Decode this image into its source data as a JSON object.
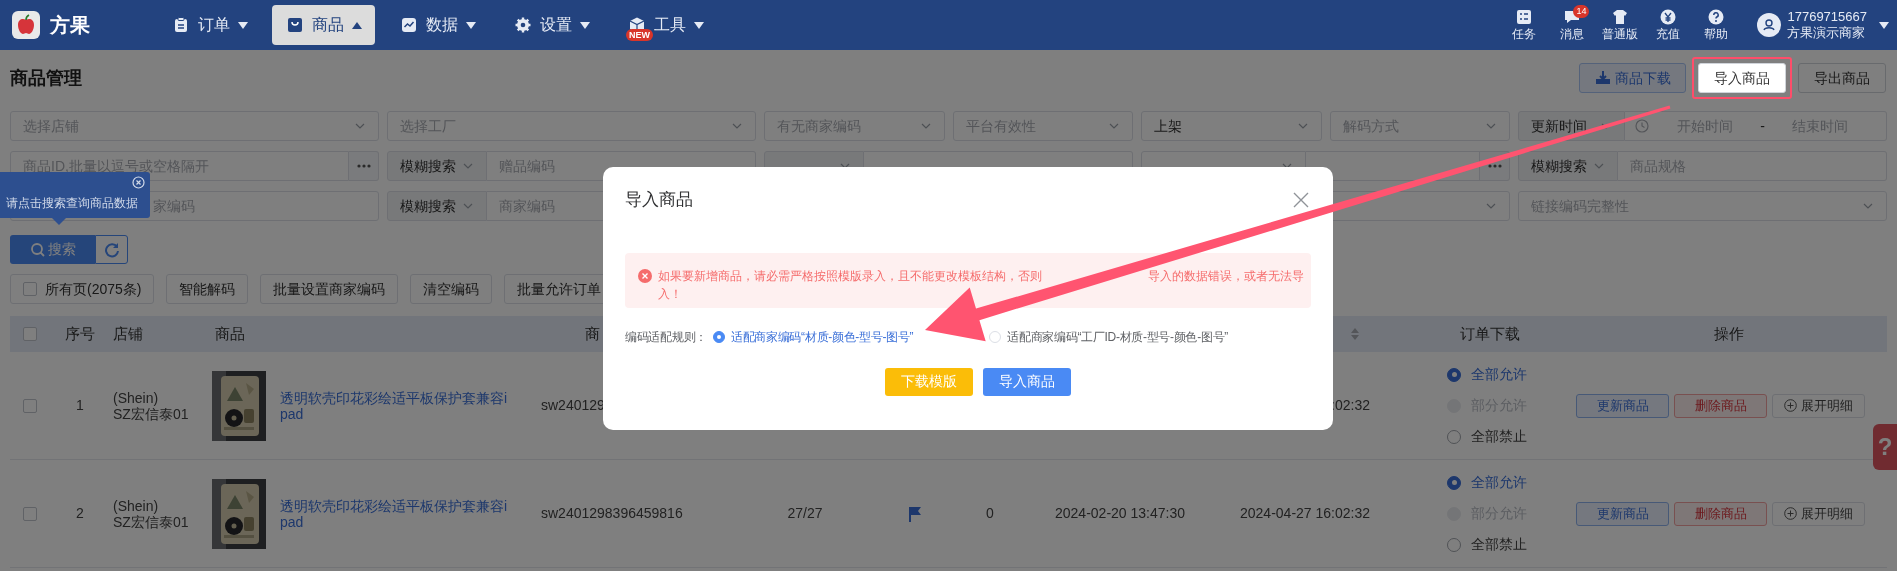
{
  "header": {
    "brand": "方果",
    "nav": [
      {
        "label": "订单",
        "selected": false
      },
      {
        "label": "商品",
        "selected": true
      },
      {
        "label": "数据",
        "selected": false
      },
      {
        "label": "设置",
        "selected": false
      },
      {
        "label": "工具",
        "selected": false,
        "badge": "NEW"
      }
    ],
    "tools": [
      {
        "label": "任务"
      },
      {
        "label": "消息",
        "badge": "14"
      },
      {
        "label": "普通版"
      },
      {
        "label": "充值"
      },
      {
        "label": "帮助"
      }
    ],
    "user": {
      "phone": "17769715667",
      "name": "方果演示商家"
    }
  },
  "page_title": "商品管理",
  "top_buttons": [
    {
      "label": "商品下载",
      "kind": "primary",
      "highlighted": false
    },
    {
      "label": "导入商品",
      "kind": "default",
      "highlighted": true
    },
    {
      "label": "导出商品",
      "kind": "default",
      "highlighted": false
    }
  ],
  "filters": [
    [
      {
        "kind": "select",
        "placeholder": "选择店铺"
      },
      {
        "kind": "select",
        "placeholder": "选择工厂"
      },
      {
        "kind": "select",
        "placeholder": "有无商家编码"
      },
      {
        "kind": "select",
        "placeholder": "平台有效性"
      },
      {
        "kind": "select",
        "value": "上架"
      },
      {
        "kind": "select",
        "placeholder": "解码方式"
      },
      {
        "kind": "date_range",
        "field": "更新时间",
        "start": "开始时间",
        "separator": "-",
        "end": "结束时间"
      }
    ],
    [
      {
        "kind": "input_more",
        "placeholder": "商品ID,批量以逗号或空格隔开"
      },
      {
        "kind": "combo",
        "mode": "模糊搜索",
        "placeholder": "赠品编码"
      },
      {
        "kind": "combo"
      },
      {
        "kind": "select_input_more"
      },
      {
        "kind": "combo",
        "mode": "模糊搜索",
        "placeholder": "商品规格"
      }
    ],
    [
      {
        "kind": "input",
        "placeholder": "家编码"
      },
      {
        "kind": "combo",
        "mode": "模糊搜索",
        "placeholder": "商家编码"
      },
      {
        "kind": "select"
      },
      {
        "kind": "select",
        "placeholder": "链接编码完整性"
      }
    ]
  ],
  "tooltip": {
    "text": "请点击搜索查询商品数据"
  },
  "search_button": {
    "label": "搜索"
  },
  "actions": [
    {
      "kind": "checkbox",
      "label": "所有页(2075条)",
      "checked": false
    },
    {
      "kind": "button",
      "label": "智能解码"
    },
    {
      "kind": "button",
      "label": "批量设置商家编码"
    },
    {
      "kind": "button",
      "label": "清空编码"
    },
    {
      "kind": "button",
      "label": "批量允许订单"
    }
  ],
  "table": {
    "columns": [
      {
        "kind": "checkbox",
        "checked": false
      },
      {
        "label": "序号"
      },
      {
        "label": "店铺"
      },
      {
        "label": "商品"
      },
      {
        "label": "商"
      },
      {},
      {},
      {},
      {},
      {
        "sortable": true
      },
      {
        "label": "订单下载"
      },
      {
        "label": "操作"
      }
    ],
    "rows": [
      {
        "checked": false,
        "index": "1",
        "shop": "(Shein) SZ宏信泰01",
        "title": "透明软壳印花彩绘适平板保护套兼容ipad",
        "code": "sw240129",
        "updated": ":02:32",
        "order_download": [
          {
            "label": "全部允许",
            "selected": true,
            "disabled": false
          },
          {
            "label": "部分允许",
            "selected": false,
            "disabled": true
          },
          {
            "label": "全部禁止",
            "selected": false,
            "disabled": false
          }
        ],
        "actions": [
          {
            "kind": "update",
            "label": "更新商品"
          },
          {
            "kind": "delete",
            "label": "删除商品"
          },
          {
            "kind": "expand",
            "label": "展开明细"
          }
        ]
      },
      {
        "checked": false,
        "index": "2",
        "shop": "(Shein) SZ宏信泰01",
        "title": "透明软壳印花彩绘适平板保护套兼容ipad",
        "code": "sw2401298396459816",
        "stock": "27/27",
        "flagged": true,
        "count": "0",
        "created": "2024-02-20 13:47:30",
        "updated": "2024-04-27 16:02:32",
        "order_download": [
          {
            "label": "全部允许",
            "selected": true,
            "disabled": false
          },
          {
            "label": "部分允许",
            "selected": false,
            "disabled": true
          },
          {
            "label": "全部禁止",
            "selected": false,
            "disabled": false
          }
        ],
        "actions": [
          {
            "kind": "update",
            "label": "更新商品"
          },
          {
            "kind": "delete",
            "label": "删除商品"
          },
          {
            "kind": "expand",
            "label": "展开明细"
          }
        ]
      }
    ]
  },
  "help_tab": {
    "text": "?"
  },
  "modal": {
    "title": "导入商品",
    "alert": [
      [
        "如果要新增商品，请必需严格按照模版录入，且不能更改模板结构，否则",
        "导入的数据错误，或者无法导"
      ],
      [
        "入！"
      ]
    ],
    "rule_label": "编码适配规则：",
    "rules": [
      {
        "label": "适配商家编码“材质-颜色-型号-图号”",
        "selected": true
      },
      {
        "label": "适配商家编码“工厂ID-材质-型号-颜色-图号”",
        "selected": false
      }
    ],
    "buttons": [
      {
        "kind": "warning",
        "label": "下载模版"
      },
      {
        "kind": "primary",
        "label": "导入商品"
      }
    ]
  }
}
